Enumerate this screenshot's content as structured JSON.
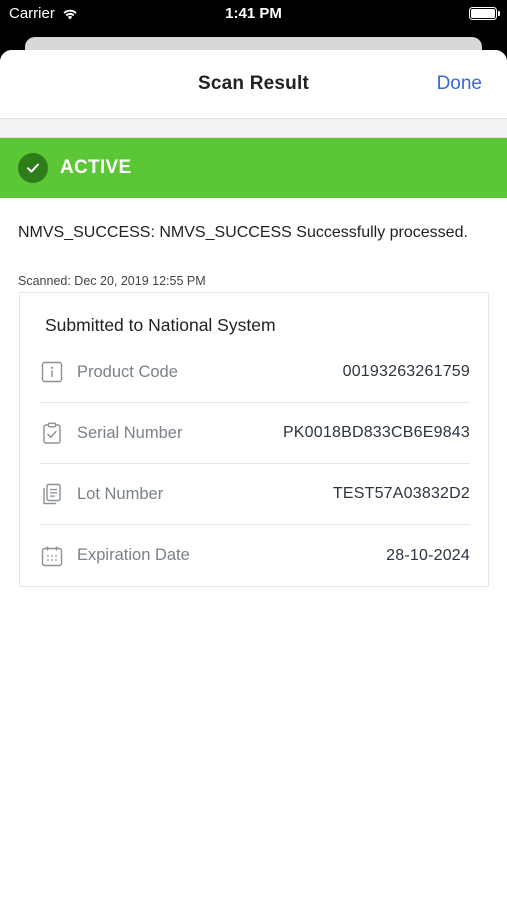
{
  "status_bar": {
    "carrier": "Carrier",
    "time": "1:41 PM"
  },
  "nav": {
    "title": "Scan Result",
    "done_label": "Done"
  },
  "status": {
    "label": "ACTIVE",
    "color": "#5bc736"
  },
  "message": "NMVS_SUCCESS: NMVS_SUCCESS Successfully processed.",
  "scanned": "Scanned: Dec 20, 2019 12:55 PM",
  "card": {
    "title": "Submitted to National System",
    "rows": [
      {
        "icon": "info-icon",
        "label": "Product Code",
        "value": "00193263261759"
      },
      {
        "icon": "clipboard-check-icon",
        "label": "Serial Number",
        "value": "PK0018BD833CB6E9843"
      },
      {
        "icon": "document-list-icon",
        "label": "Lot Number",
        "value": "TEST57A03832D2"
      },
      {
        "icon": "calendar-icon",
        "label": "Expiration Date",
        "value": "28-10-2024"
      }
    ]
  }
}
